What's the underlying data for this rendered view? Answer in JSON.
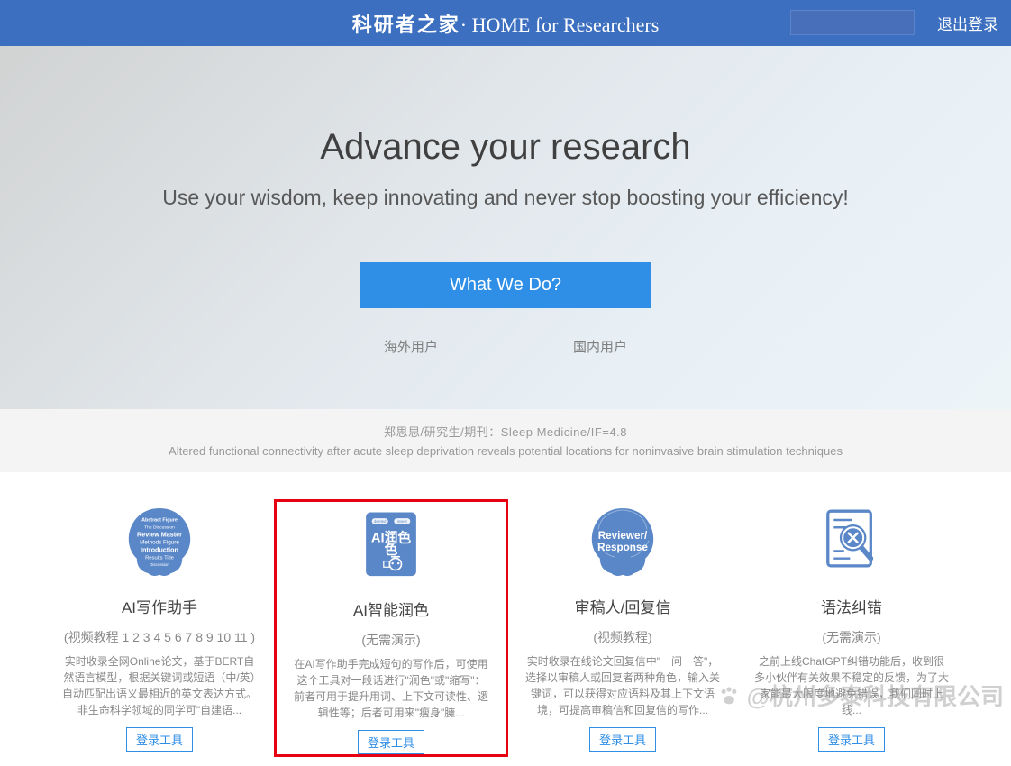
{
  "header": {
    "brand_cn": "科研者之家",
    "brand_sep": "· ",
    "brand_en": "HOME for Researchers",
    "logout": "退出登录",
    "search_value": ""
  },
  "hero": {
    "title": "Advance your research",
    "subtitle": "Use your wisdom, keep innovating and never stop boosting your efficiency!",
    "cta": "What We Do?",
    "links": {
      "overseas": "海外用户",
      "domestic": "国内用户"
    }
  },
  "info": {
    "line1": "郑思思/研究生/期刊：Sleep Medicine/IF=4.8",
    "line2": "Altered functional connectivity after acute sleep deprivation reveals potential locations for noninvasive brain stimulation techniques"
  },
  "cards": [
    {
      "title": "AI写作助手",
      "subtitle": "(视频教程 1 2 3 4 5 6 7 8 9 10 11 )",
      "desc": "实时收录全网Online论文，基于BERT自然语言模型，根据关键词或短语（中/英）自动匹配出语义最相近的英文表达方式。非生命科学领域的同学可\"自建语...",
      "button": "登录工具",
      "icon": "brain-words",
      "icon_lines": [
        "Abstract Figure",
        "The Discussion",
        "Review Master",
        "Methods Figure",
        "Introduction",
        "Results Title",
        "Discussion"
      ]
    },
    {
      "title": "AI智能润色",
      "subtitle": "(无需演示)",
      "desc": "在AI写作助手完成短句的写作后，可使用这个工具对一段话进行\"润色\"或\"缩写\"：前者可用于提升用词、上下文可读性、逻辑性等；后者可用来\"瘦身\"臃...",
      "button": "登录工具",
      "icon": "doc-ai",
      "icon_label_top": "deleted   insect",
      "icon_label_main": "AI润色"
    },
    {
      "title": "审稿人/回复信",
      "subtitle": "(视频教程)",
      "desc": "实时收录在线论文回复信中\"一问一答\"，选择以审稿人或回复者两种角色，输入关键词，可以获得对应语料及其上下文语境，可提高审稿信和回复信的写作...",
      "button": "登录工具",
      "icon": "brain-reviewer",
      "icon_text1": "Reviewer/",
      "icon_text2": "Response"
    },
    {
      "title": "语法纠错",
      "subtitle": "(无需演示)",
      "desc": "之前上线ChatGPT纠错功能后，收到很多小伙伴有关效果不稳定的反馈，为了大家能最大限度地避免错误，我们同时上线...",
      "button": "登录工具",
      "icon": "magnifier-x"
    }
  ],
  "watermark": "@杭州多泰科技有限公司"
}
